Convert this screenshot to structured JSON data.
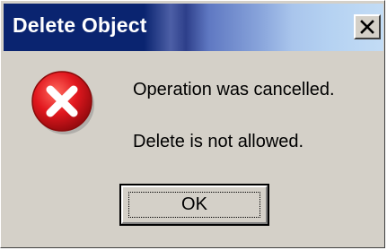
{
  "window": {
    "title": "Delete Object",
    "close_icon": "close-x-icon"
  },
  "content": {
    "icon": "error-icon",
    "message_line1": "Operation was cancelled.",
    "message_line2": "Delete is not allowed."
  },
  "buttons": {
    "ok_label": "OK"
  },
  "colors": {
    "dialog_face": "#d4d0c8",
    "titlebar_start": "#0a2470",
    "titlebar_end": "#c3dcf5",
    "error_red": "#e1171e"
  }
}
